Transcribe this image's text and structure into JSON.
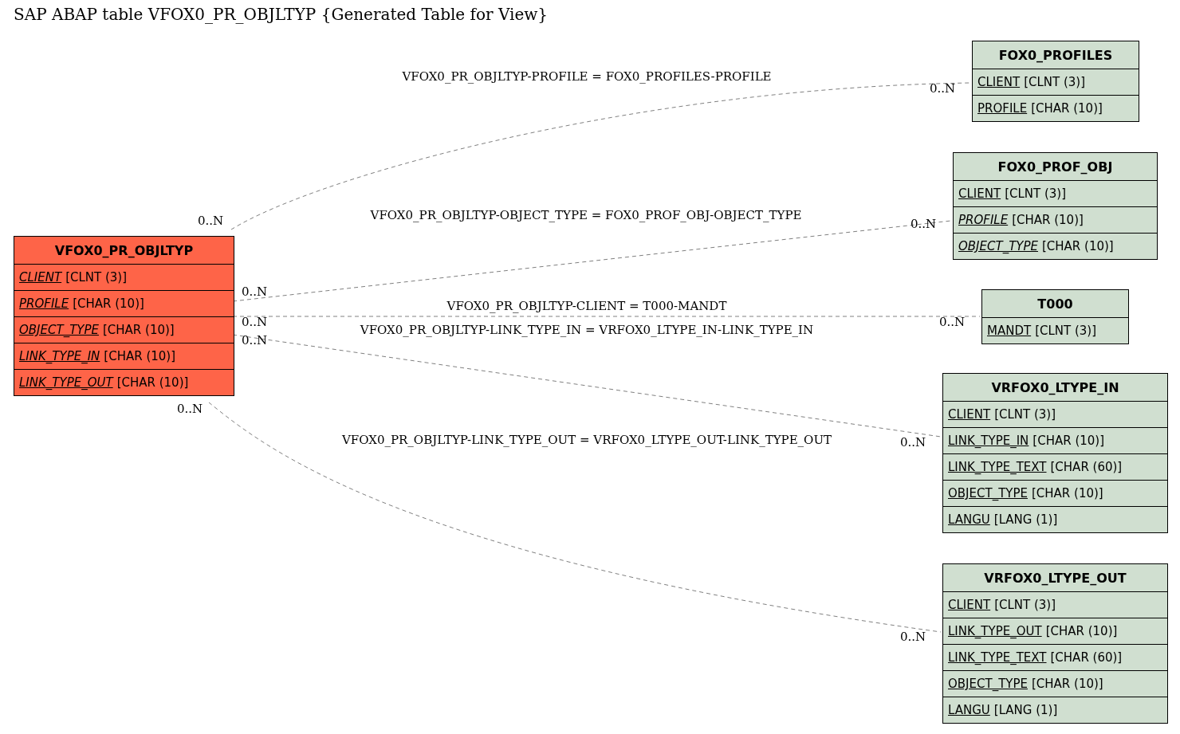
{
  "title": "SAP ABAP table VFOX0_PR_OBJLTYP {Generated Table for View}",
  "tables": [
    {
      "name": "VFOX0_PR_OBJLTYP",
      "kind": "main",
      "fields": [
        {
          "name": "CLIENT",
          "type": "[CLNT (3)]",
          "key": true,
          "foreign": true
        },
        {
          "name": "PROFILE",
          "type": "[CHAR (10)]",
          "key": true,
          "foreign": true
        },
        {
          "name": "OBJECT_TYPE",
          "type": "[CHAR (10)]",
          "key": true,
          "foreign": true
        },
        {
          "name": "LINK_TYPE_IN",
          "type": "[CHAR (10)]",
          "key": true,
          "foreign": true
        },
        {
          "name": "LINK_TYPE_OUT",
          "type": "[CHAR (10)]",
          "key": true,
          "foreign": true
        }
      ]
    },
    {
      "name": "FOX0_PROFILES",
      "kind": "related",
      "fields": [
        {
          "name": "CLIENT",
          "type": "[CLNT (3)]",
          "key": true,
          "foreign": false
        },
        {
          "name": "PROFILE",
          "type": "[CHAR (10)]",
          "key": true,
          "foreign": false
        }
      ]
    },
    {
      "name": "FOX0_PROF_OBJ",
      "kind": "related",
      "fields": [
        {
          "name": "CLIENT",
          "type": "[CLNT (3)]",
          "key": true,
          "foreign": false
        },
        {
          "name": "PROFILE",
          "type": "[CHAR (10)]",
          "key": true,
          "foreign": true
        },
        {
          "name": "OBJECT_TYPE",
          "type": "[CHAR (10)]",
          "key": true,
          "foreign": true
        }
      ]
    },
    {
      "name": "T000",
      "kind": "related",
      "fields": [
        {
          "name": "MANDT",
          "type": "[CLNT (3)]",
          "key": true,
          "foreign": false
        }
      ]
    },
    {
      "name": "VRFOX0_LTYPE_IN",
      "kind": "related",
      "fields": [
        {
          "name": "CLIENT",
          "type": "[CLNT (3)]",
          "key": true,
          "foreign": false
        },
        {
          "name": "LINK_TYPE_IN",
          "type": "[CHAR (10)]",
          "key": true,
          "foreign": false
        },
        {
          "name": "LINK_TYPE_TEXT",
          "type": "[CHAR (60)]",
          "key": true,
          "foreign": false
        },
        {
          "name": "OBJECT_TYPE",
          "type": "[CHAR (10)]",
          "key": true,
          "foreign": false
        },
        {
          "name": "LANGU",
          "type": "[LANG (1)]",
          "key": true,
          "foreign": false
        }
      ]
    },
    {
      "name": "VRFOX0_LTYPE_OUT",
      "kind": "related",
      "fields": [
        {
          "name": "CLIENT",
          "type": "[CLNT (3)]",
          "key": true,
          "foreign": false
        },
        {
          "name": "LINK_TYPE_OUT",
          "type": "[CHAR (10)]",
          "key": true,
          "foreign": false
        },
        {
          "name": "LINK_TYPE_TEXT",
          "type": "[CHAR (60)]",
          "key": true,
          "foreign": false
        },
        {
          "name": "OBJECT_TYPE",
          "type": "[CHAR (10)]",
          "key": true,
          "foreign": false
        },
        {
          "name": "LANGU",
          "type": "[LANG (1)]",
          "key": true,
          "foreign": false
        }
      ]
    }
  ],
  "relations": [
    {
      "label": "VFOX0_PR_OBJLTYP-PROFILE = FOX0_PROFILES-PROFILE",
      "from_cardinality": "0..N",
      "to_cardinality": "0..N"
    },
    {
      "label": "VFOX0_PR_OBJLTYP-OBJECT_TYPE = FOX0_PROF_OBJ-OBJECT_TYPE",
      "from_cardinality": "0..N",
      "to_cardinality": "0..N"
    },
    {
      "label": "VFOX0_PR_OBJLTYP-CLIENT = T000-MANDT",
      "from_cardinality": "0..N",
      "to_cardinality": "0..N"
    },
    {
      "label": "VFOX0_PR_OBJLTYP-LINK_TYPE_IN = VRFOX0_LTYPE_IN-LINK_TYPE_IN",
      "from_cardinality": "0..N",
      "to_cardinality": "0..N"
    },
    {
      "label": "VFOX0_PR_OBJLTYP-LINK_TYPE_OUT = VRFOX0_LTYPE_OUT-LINK_TYPE_OUT",
      "from_cardinality": "0..N",
      "to_cardinality": "0..N"
    }
  ]
}
